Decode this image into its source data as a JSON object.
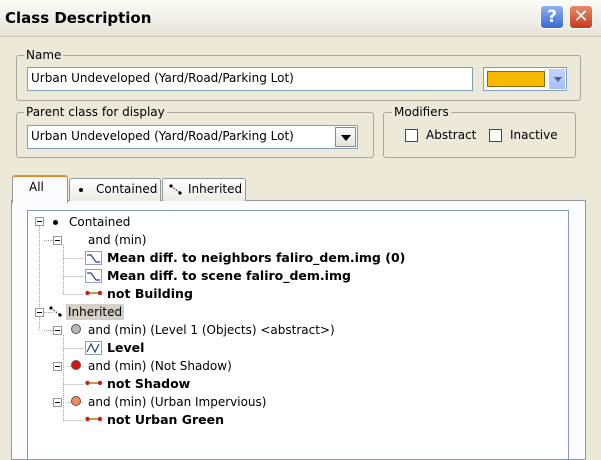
{
  "window": {
    "title": "Class Description",
    "help_glyph": "?",
    "close_glyph": "✕"
  },
  "name_group": {
    "label": "Name",
    "value": "Urban Undeveloped (Yard/Road/Parking Lot)",
    "color": "#f7b800"
  },
  "parent_group": {
    "label": "Parent class for display",
    "value": "Urban Undeveloped (Yard/Road/Parking Lot)"
  },
  "modifiers": {
    "label": "Modifiers",
    "abstract_label": "Abstract",
    "abstract_checked": false,
    "inactive_label": "Inactive",
    "inactive_checked": false
  },
  "tabs": [
    {
      "label": "All",
      "icon": "none"
    },
    {
      "label": "Contained",
      "icon": "dot-icon"
    },
    {
      "label": "Inherited",
      "icon": "inherit-icon"
    }
  ],
  "tree": {
    "contained": "Contained",
    "and_min": "and (min)",
    "mean_diff_neighbors": "Mean diff. to neighbors faliro_dem.img  (0)",
    "mean_diff_scene": "Mean diff. to scene faliro_dem.img",
    "not_building": "not Building",
    "inherited": "Inherited",
    "level1": "and (min) (Level 1 (Objects) <abstract>)",
    "level": "Level",
    "not_shadow_group": "and (min) (Not Shadow)",
    "not_shadow": "not Shadow",
    "urban_impervious_group": "and (min) (Urban Impervious)",
    "not_urban_green": "not Urban Green",
    "colors": {
      "level1": "#b8b8b8",
      "not_shadow": "#e01010",
      "urban_impervious": "#f08a5a"
    }
  }
}
